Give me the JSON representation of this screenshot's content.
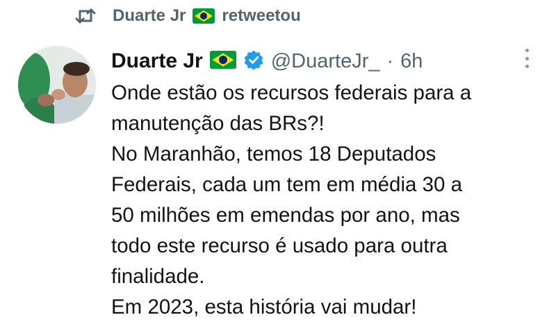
{
  "retweet": {
    "user": "Duarte Jr",
    "action": "retweetou"
  },
  "tweet": {
    "author_name": "Duarte Jr",
    "handle": "@DuarteJr_",
    "separator": "·",
    "time": "6h",
    "lines": [
      "Onde estão os recursos federais para a",
      "manutenção das BRs?!",
      "No Maranhão, temos 18 Deputados",
      "Federais, cada um tem em média 30 a",
      "50 milhões em emendas por ano, mas",
      "todo este recurso é usado para outra",
      "finalidade.",
      "Em 2023, esta história vai mudar!"
    ]
  },
  "icons": {
    "retweet": "retweet-icon",
    "flag": "brazil-flag-icon",
    "verified": "verified-badge-icon",
    "more": "more-options-icon"
  },
  "colors": {
    "verified": "#1d9bf0",
    "secondary_text": "#536471",
    "flag_green": "#009c3b",
    "flag_yellow": "#ffdf00",
    "flag_blue": "#002776"
  }
}
